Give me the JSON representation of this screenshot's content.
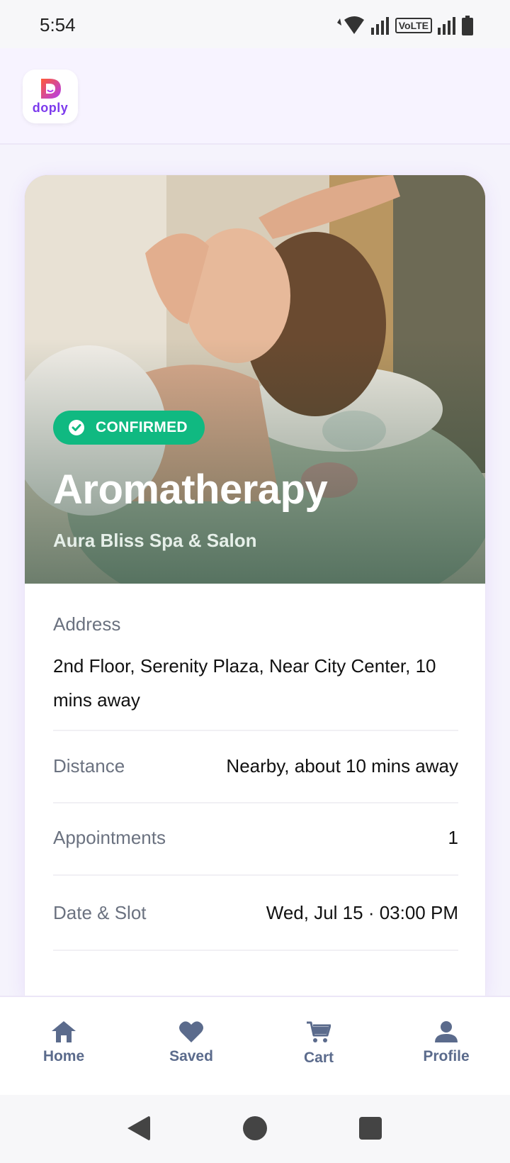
{
  "status_bar": {
    "time": "5:54",
    "network_label": "VoLTE"
  },
  "header": {
    "logo_text": "doply"
  },
  "booking": {
    "status": "CONFIRMED",
    "title": "Aromatherapy",
    "venue": "Aura Bliss Spa & Salon",
    "address_label": "Address",
    "address_value": "2nd Floor, Serenity Plaza, Near City Center, 10 mins away",
    "rows": [
      {
        "label": "Distance",
        "value": "Nearby, about 10 mins away"
      },
      {
        "label": "Appointments",
        "value": "1"
      },
      {
        "label": "Date & Slot",
        "value": "Wed, Jul 15 · 03:00 PM"
      }
    ]
  },
  "nav": [
    {
      "label": "Home",
      "icon": "home-icon"
    },
    {
      "label": "Saved",
      "icon": "heart-icon"
    },
    {
      "label": "Cart",
      "icon": "cart-icon"
    },
    {
      "label": "Profile",
      "icon": "person-icon"
    }
  ],
  "colors": {
    "accent": "#7c3aed",
    "confirmed": "#10b981",
    "nav": "#5b6b8c"
  }
}
